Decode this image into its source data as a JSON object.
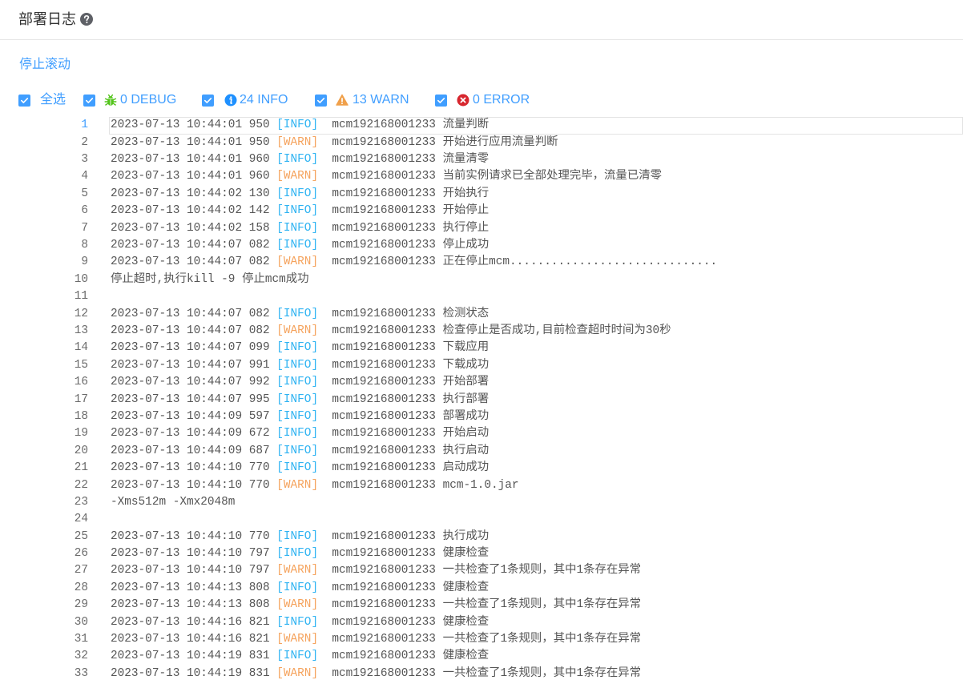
{
  "header": {
    "title": "部署日志",
    "help_icon": "question-circle-icon"
  },
  "actions": {
    "stop_scroll": "停止滚动"
  },
  "filters": {
    "all": {
      "label": "全选",
      "checked": true
    },
    "debug": {
      "count": 0,
      "level": "DEBUG",
      "icon": "bug-icon",
      "checked": true
    },
    "info": {
      "count": 24,
      "level": "INFO",
      "icon": "info-circle-icon",
      "checked": true
    },
    "warn": {
      "count": 13,
      "level": "WARN",
      "icon": "warning-triangle-icon",
      "checked": true
    },
    "error": {
      "count": 0,
      "level": "ERROR",
      "icon": "close-circle-icon",
      "checked": true
    }
  },
  "colors": {
    "accent": "#409eff",
    "info_level": "#2eb3f2",
    "warn_level": "#f5a35d",
    "log_text": "#555555",
    "line_number": "#6b6b6b",
    "debug_icon": "#52c41a",
    "info_icon": "#1e90ff",
    "warn_icon": "#f0a04b",
    "error_icon": "#d7262e",
    "help_icon": "#5e6066"
  },
  "log": {
    "active_line": 1,
    "lines": [
      {
        "no": 1,
        "time": "2023-07-13 10:44:01 950",
        "level": "[INFO]",
        "source": "mcm192168001233",
        "message": "流量判断"
      },
      {
        "no": 2,
        "time": "2023-07-13 10:44:01 950",
        "level": "[WARN]",
        "source": "mcm192168001233",
        "message": "开始进行应用流量判断"
      },
      {
        "no": 3,
        "time": "2023-07-13 10:44:01 960",
        "level": "[INFO]",
        "source": "mcm192168001233",
        "message": "流量清零"
      },
      {
        "no": 4,
        "time": "2023-07-13 10:44:01 960",
        "level": "[WARN]",
        "source": "mcm192168001233",
        "message": "当前实例请求已全部处理完毕，流量已清零"
      },
      {
        "no": 5,
        "time": "2023-07-13 10:44:02 130",
        "level": "[INFO]",
        "source": "mcm192168001233",
        "message": "开始执行"
      },
      {
        "no": 6,
        "time": "2023-07-13 10:44:02 142",
        "level": "[INFO]",
        "source": "mcm192168001233",
        "message": "开始停止"
      },
      {
        "no": 7,
        "time": "2023-07-13 10:44:02 158",
        "level": "[INFO]",
        "source": "mcm192168001233",
        "message": "执行停止"
      },
      {
        "no": 8,
        "time": "2023-07-13 10:44:07 082",
        "level": "[INFO]",
        "source": "mcm192168001233",
        "message": "停止成功"
      },
      {
        "no": 9,
        "time": "2023-07-13 10:44:07 082",
        "level": "[WARN]",
        "source": "mcm192168001233",
        "message": "正在停止mcm.............................."
      },
      {
        "no": 10,
        "text": "停止超时,执行kill -9 停止mcm成功"
      },
      {
        "no": 11,
        "text": ""
      },
      {
        "no": 12,
        "time": "2023-07-13 10:44:07 082",
        "level": "[INFO]",
        "source": "mcm192168001233",
        "message": "检测状态"
      },
      {
        "no": 13,
        "time": "2023-07-13 10:44:07 082",
        "level": "[WARN]",
        "source": "mcm192168001233",
        "message": "检查停止是否成功,目前检查超时时间为30秒"
      },
      {
        "no": 14,
        "time": "2023-07-13 10:44:07 099",
        "level": "[INFO]",
        "source": "mcm192168001233",
        "message": "下载应用"
      },
      {
        "no": 15,
        "time": "2023-07-13 10:44:07 991",
        "level": "[INFO]",
        "source": "mcm192168001233",
        "message": "下载成功"
      },
      {
        "no": 16,
        "time": "2023-07-13 10:44:07 992",
        "level": "[INFO]",
        "source": "mcm192168001233",
        "message": "开始部署"
      },
      {
        "no": 17,
        "time": "2023-07-13 10:44:07 995",
        "level": "[INFO]",
        "source": "mcm192168001233",
        "message": "执行部署"
      },
      {
        "no": 18,
        "time": "2023-07-13 10:44:09 597",
        "level": "[INFO]",
        "source": "mcm192168001233",
        "message": "部署成功"
      },
      {
        "no": 19,
        "time": "2023-07-13 10:44:09 672",
        "level": "[INFO]",
        "source": "mcm192168001233",
        "message": "开始启动"
      },
      {
        "no": 20,
        "time": "2023-07-13 10:44:09 687",
        "level": "[INFO]",
        "source": "mcm192168001233",
        "message": "执行启动"
      },
      {
        "no": 21,
        "time": "2023-07-13 10:44:10 770",
        "level": "[INFO]",
        "source": "mcm192168001233",
        "message": "启动成功"
      },
      {
        "no": 22,
        "time": "2023-07-13 10:44:10 770",
        "level": "[WARN]",
        "source": "mcm192168001233",
        "message": "mcm-1.0.jar"
      },
      {
        "no": 23,
        "text": "-Xms512m -Xmx2048m"
      },
      {
        "no": 24,
        "text": ""
      },
      {
        "no": 25,
        "time": "2023-07-13 10:44:10 770",
        "level": "[INFO]",
        "source": "mcm192168001233",
        "message": "执行成功"
      },
      {
        "no": 26,
        "time": "2023-07-13 10:44:10 797",
        "level": "[INFO]",
        "source": "mcm192168001233",
        "message": "健康检查"
      },
      {
        "no": 27,
        "time": "2023-07-13 10:44:10 797",
        "level": "[WARN]",
        "source": "mcm192168001233",
        "message": "一共检查了1条规则，其中1条存在异常"
      },
      {
        "no": 28,
        "time": "2023-07-13 10:44:13 808",
        "level": "[INFO]",
        "source": "mcm192168001233",
        "message": "健康检查"
      },
      {
        "no": 29,
        "time": "2023-07-13 10:44:13 808",
        "level": "[WARN]",
        "source": "mcm192168001233",
        "message": "一共检查了1条规则，其中1条存在异常"
      },
      {
        "no": 30,
        "time": "2023-07-13 10:44:16 821",
        "level": "[INFO]",
        "source": "mcm192168001233",
        "message": "健康检查"
      },
      {
        "no": 31,
        "time": "2023-07-13 10:44:16 821",
        "level": "[WARN]",
        "source": "mcm192168001233",
        "message": "一共检查了1条规则，其中1条存在异常"
      },
      {
        "no": 32,
        "time": "2023-07-13 10:44:19 831",
        "level": "[INFO]",
        "source": "mcm192168001233",
        "message": "健康检查"
      },
      {
        "no": 33,
        "time": "2023-07-13 10:44:19 831",
        "level": "[WARN]",
        "source": "mcm192168001233",
        "message": "一共检查了1条规则，其中1条存在异常"
      }
    ]
  }
}
